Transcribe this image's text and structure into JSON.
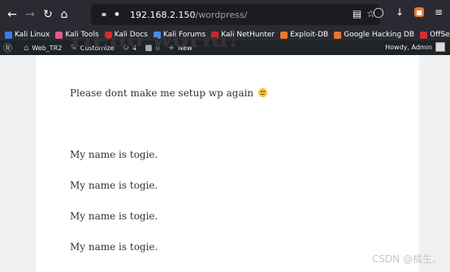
{
  "browser": {
    "url_host": "192.168.2.150",
    "url_path": "/wordpress/"
  },
  "bookmarks": [
    {
      "label": "Kali Linux",
      "color": "#367bf0"
    },
    {
      "label": "Kali Tools",
      "color": "#e05a8e"
    },
    {
      "label": "Kali Docs",
      "color": "#d32f2f"
    },
    {
      "label": "Kali Forums",
      "color": "#4a90d9"
    },
    {
      "label": "Kali NetHunter",
      "color": "#c62828"
    },
    {
      "label": "Exploit-DB",
      "color": "#e8772e"
    },
    {
      "label": "Google Hacking DB",
      "color": "#e8772e"
    },
    {
      "label": "OffSec",
      "color": "#d32f2f"
    }
  ],
  "adminbar": {
    "site_name": "Web_TR2",
    "customize": "Customize",
    "updates_count": "4",
    "comments_count": "0",
    "new_label": "New",
    "greeting": "Howdy, Admin"
  },
  "post": {
    "title": "Hello world!",
    "intro": "Please dont make me setup wp again",
    "lines": [
      "My name is togie.",
      "My name is togie.",
      "My name is togie.",
      "My name is togie."
    ]
  },
  "watermark": "CSDN @橘生。"
}
